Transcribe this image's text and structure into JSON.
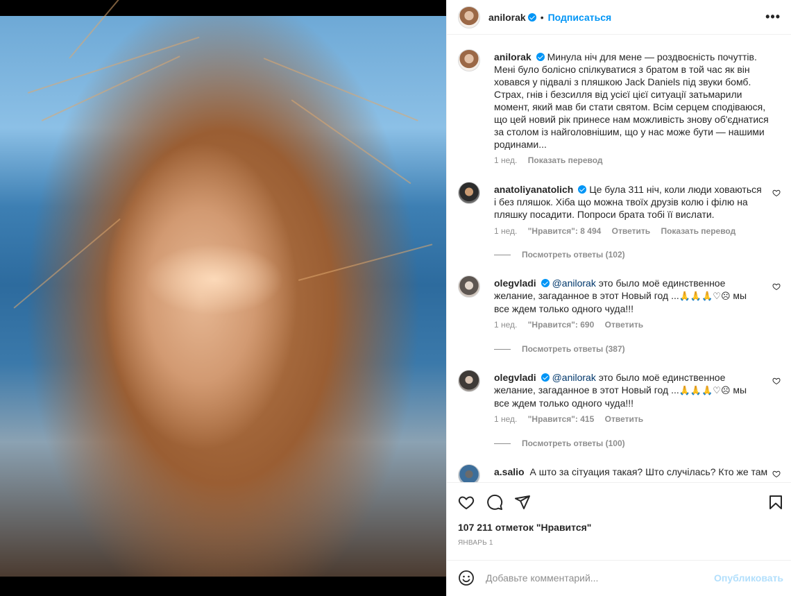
{
  "post": {
    "username": "anilorak",
    "follow_label": "Подписаться",
    "separator": "•",
    "more_label": "•••"
  },
  "caption": {
    "username": "anilorak",
    "text": "Минула ніч для мене — роздвоєність почуттів. Мені було болісно спілкуватися з братом в той час як він ховався у підвалі з пляшкою Jack Daniels під звуки бомб. Страх, гнів і безсилля від усієї цієї ситуації затьмарили момент, який мав би стати святом. Всім серцем сподіваюся, що цей новий рік принесе нам можливість знову об'єднатися за столом із найголовнішим, що у нас може бути — нашими родинами...",
    "age": "1 нед.",
    "translate_label": "Показать перевод"
  },
  "comments": [
    {
      "username": "anatoliyanatolich",
      "text": "Це була 311 ніч, коли люди ховаються і без пляшок. Хіба що можна твоїх друзів колю і філю на пляшку посадити. Попроси брата тобі її вислати.",
      "age": "1 нед.",
      "likes": "\"Нравится\": 8 494",
      "reply_label": "Ответить",
      "translate_label": "Показать перевод",
      "view_replies": "Посмотреть ответы (102)"
    },
    {
      "username": "olegvladi",
      "mention": "@anilorak",
      "text_before": "это было моё единственное желание, загаданное в этот Новый год ...",
      "emojis": "🙏🙏🙏♡☹",
      "text_after": "мы все ждем только одного чуда!!!",
      "age": "1 нед.",
      "likes": "\"Нравится\": 690",
      "reply_label": "Ответить",
      "view_replies": "Посмотреть ответы (387)"
    },
    {
      "username": "olegvladi",
      "mention": "@anilorak",
      "text_before": "это было моё единственное желание, загаданное в этот Новый год ...",
      "emojis": "🙏🙏🙏♡☹",
      "text_after": "мы все ждем только одного чуда!!!",
      "age": "1 нед.",
      "likes": "\"Нравится\": 415",
      "reply_label": "Ответить",
      "view_replies": "Посмотреть ответы (100)"
    },
    {
      "username": "a.salio",
      "text": "А што за сітуация такая? Што случілась? Кто же там"
    }
  ],
  "actions": {
    "likes_text": "107 211 отметок \"Нравится\"",
    "date_text": "ЯНВАРЬ 1",
    "icons": [
      "heart-icon",
      "comment-icon",
      "share-icon",
      "bookmark-icon"
    ]
  },
  "add_comment": {
    "placeholder": "Добавьте комментарий...",
    "publish_label": "Опубликовать"
  },
  "colors": {
    "accent": "#0095f6",
    "text": "#262626",
    "muted": "#8e8e8e",
    "publish_disabled": "#b2dffc"
  }
}
